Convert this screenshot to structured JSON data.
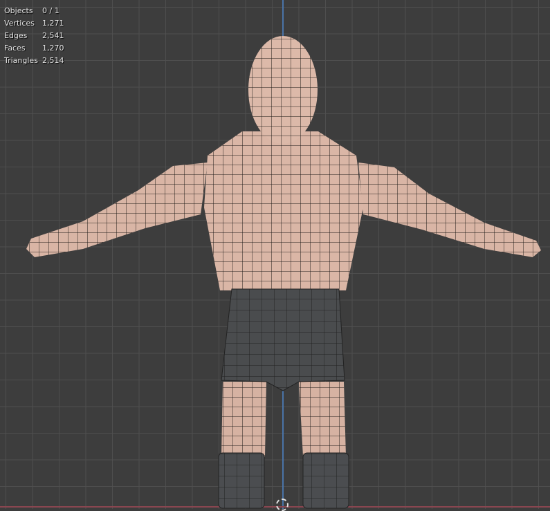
{
  "stats": [
    {
      "label": "Objects",
      "value": "0 / 1"
    },
    {
      "label": "Vertices",
      "value": "1,271"
    },
    {
      "label": "Edges",
      "value": "2,541"
    },
    {
      "label": "Faces",
      "value": "1,270"
    },
    {
      "label": "Triangles",
      "value": "2,514"
    }
  ],
  "colors": {
    "background": "#3d3d3d",
    "skin": "#d9b5a5",
    "shorts": "#4a4c4e",
    "z_axis": "#4a74a8",
    "x_axis": "#8a4650"
  }
}
